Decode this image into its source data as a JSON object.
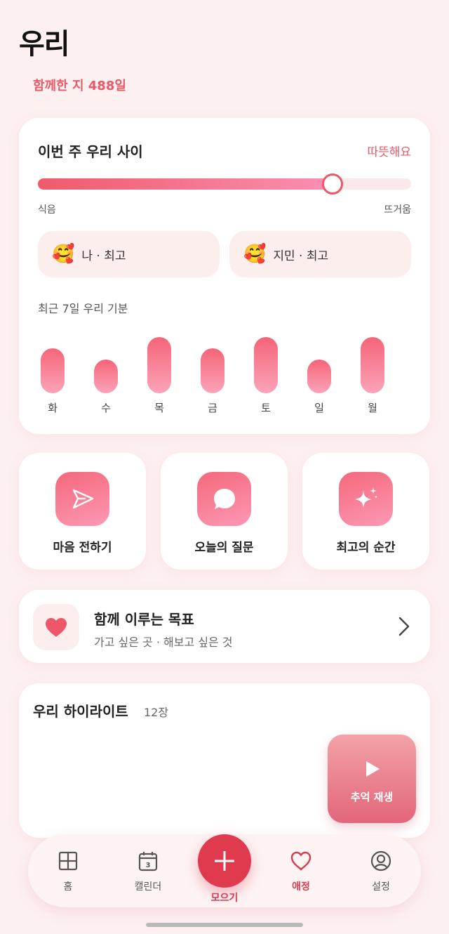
{
  "header": {
    "title": "우리",
    "days_together": "함께한 지 488일"
  },
  "relationship": {
    "title": "이번 주 우리 사이",
    "status": "따뜻해요",
    "temperature_level": 0.79,
    "scale_min_label": "식음",
    "scale_max_label": "뜨거움",
    "moods": [
      {
        "emoji": "🥰",
        "label": "나 · 최고"
      },
      {
        "emoji": "🥰",
        "label": "지민 · 최고"
      }
    ],
    "weekly_mood_title": "최근 7일 우리 기분"
  },
  "chart_data": {
    "type": "bar",
    "categories": [
      "화",
      "수",
      "목",
      "금",
      "토",
      "일",
      "월"
    ],
    "values": [
      4,
      3,
      5,
      4,
      5,
      3,
      5
    ],
    "title": "최근 7일 우리 기분",
    "ylim": [
      0,
      5
    ]
  },
  "actions": [
    {
      "label": "마음 전하기",
      "icon": "send-icon"
    },
    {
      "label": "오늘의 질문",
      "icon": "chat-bubble-icon"
    },
    {
      "label": "최고의 순간",
      "icon": "sparkle-icon"
    }
  ],
  "goal": {
    "title": "함께 이루는 목표",
    "subtitle": "가고 싶은 곳 · 해보고 싶은 것",
    "icon": "heart-icon"
  },
  "highlight": {
    "title": "우리 하이라이트",
    "count": "12장",
    "play_label": "추억 재생"
  },
  "nav": {
    "items": [
      {
        "label": "홈",
        "icon": "grid-icon"
      },
      {
        "label": "캘린더",
        "icon": "calendar-icon",
        "badge": "3"
      },
      {
        "label": "모으기",
        "icon": "plus-icon"
      },
      {
        "label": "애정",
        "icon": "heart-outline-icon"
      },
      {
        "label": "설정",
        "icon": "profile-icon"
      }
    ],
    "active": "애정"
  },
  "colors": {
    "accent": "#e03a4e",
    "background": "#fdf0f1",
    "status_text": "#ea5a66"
  }
}
